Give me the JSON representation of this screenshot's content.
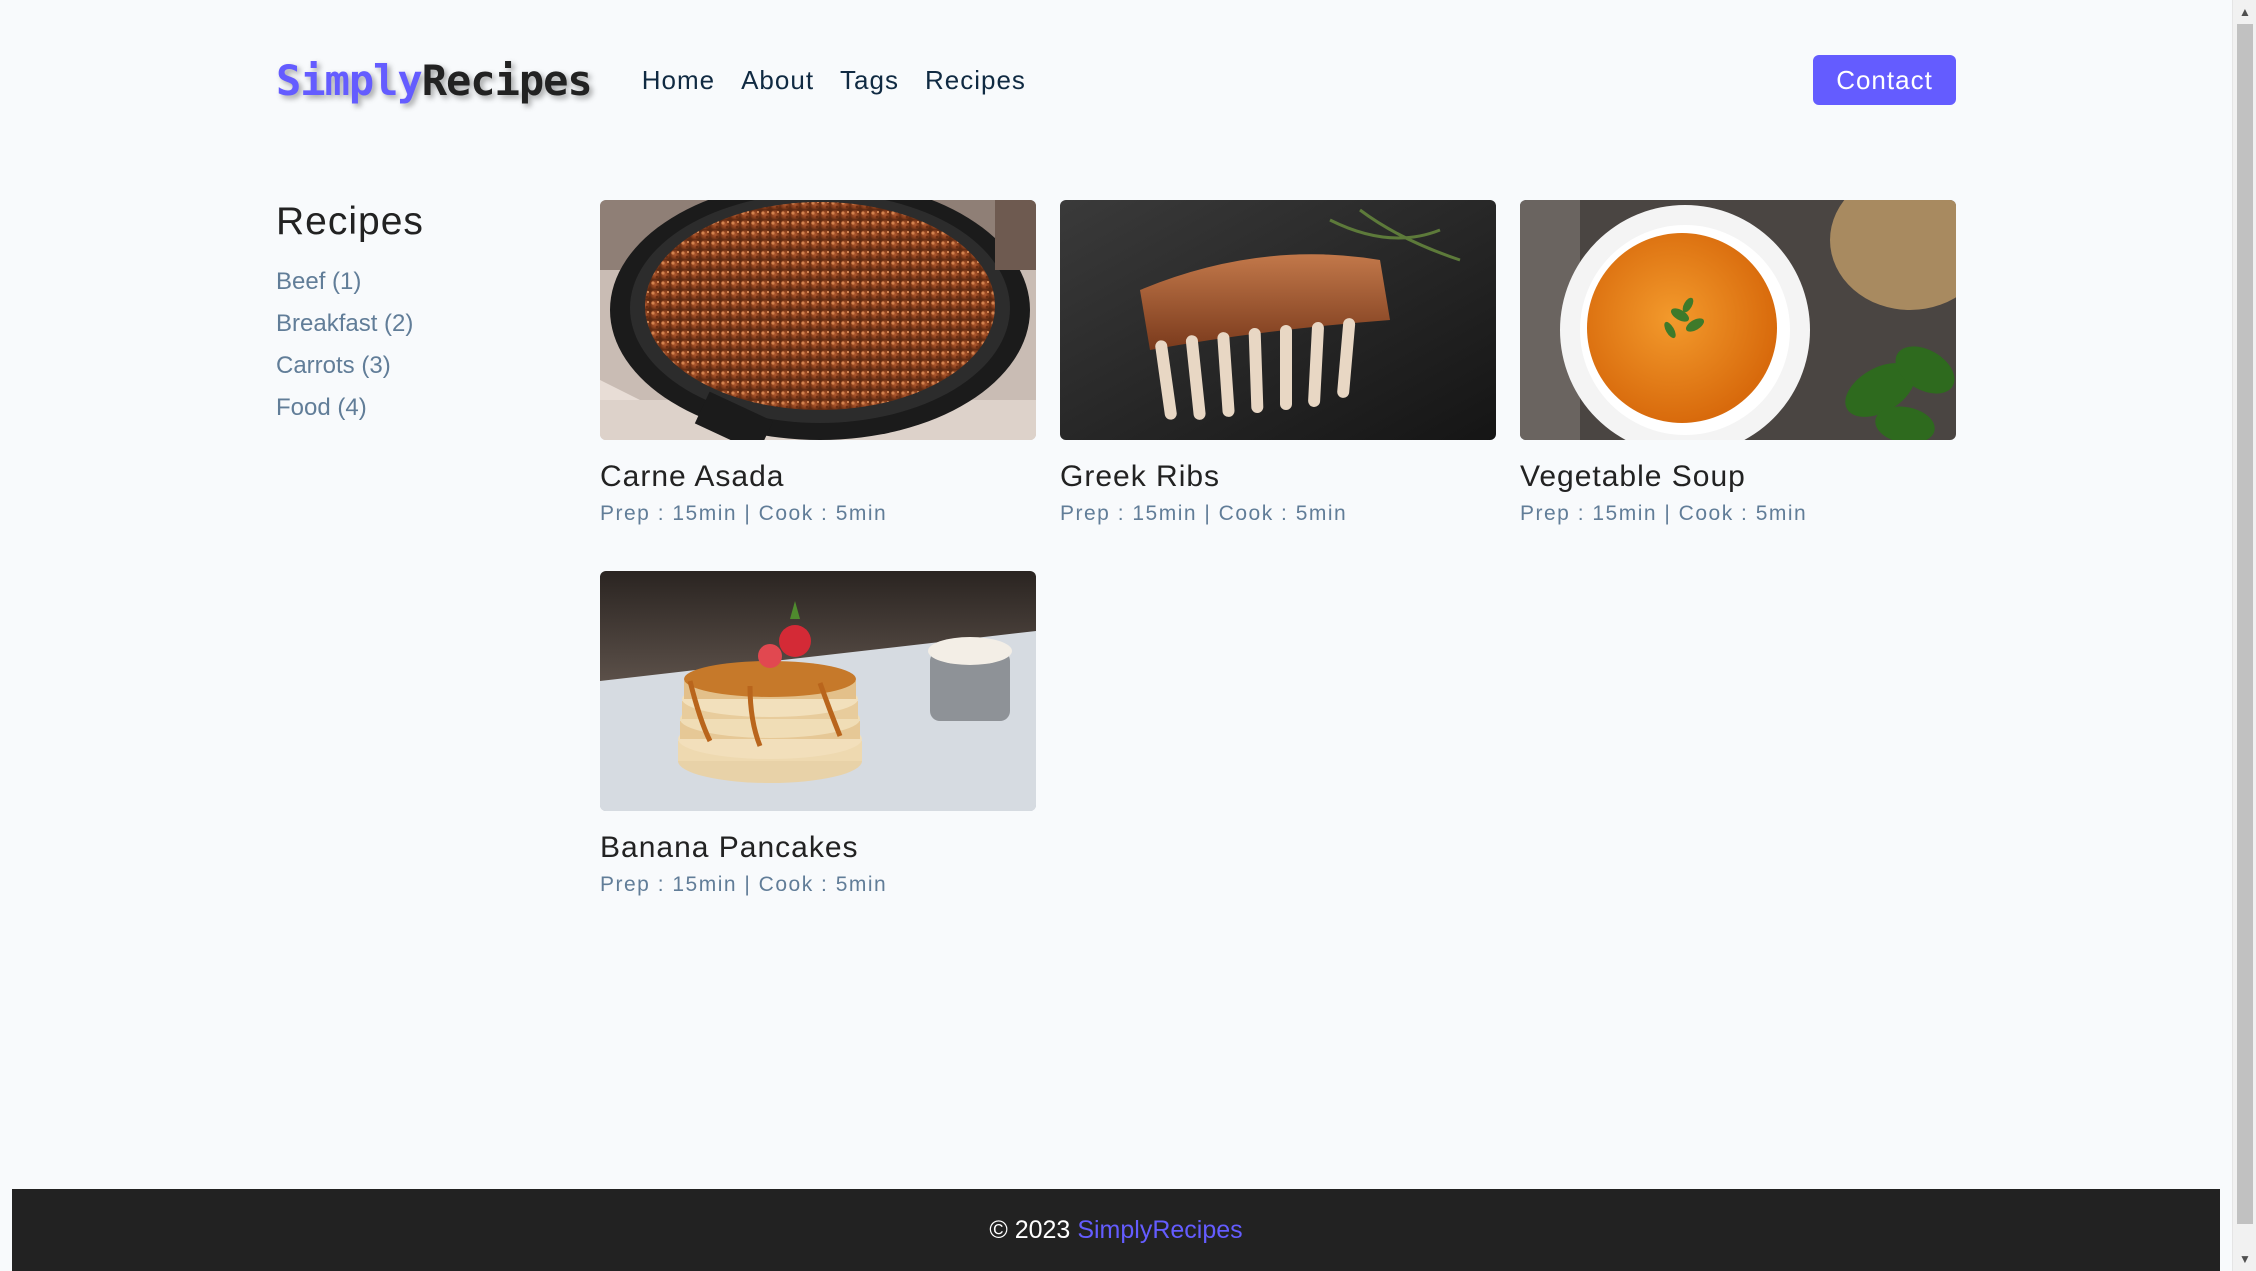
{
  "navbar": {
    "logo_part1": "Simply",
    "logo_part2": "Recipes",
    "links": [
      "Home",
      "About",
      "Tags",
      "Recipes"
    ],
    "contact_label": "Contact"
  },
  "sidebar": {
    "title": "Recipes",
    "tags": [
      "Beef (1)",
      "Breakfast (2)",
      "Carrots (3)",
      "Food (4)"
    ]
  },
  "recipes": [
    {
      "title": "Carne Asada",
      "meta": "Prep : 15min | Cook : 5min"
    },
    {
      "title": "Greek Ribs",
      "meta": "Prep : 15min | Cook : 5min"
    },
    {
      "title": "Vegetable Soup",
      "meta": "Prep : 15min | Cook : 5min"
    },
    {
      "title": "Banana Pancakes",
      "meta": "Prep : 15min | Cook : 5min"
    }
  ],
  "footer": {
    "copyright": "© 2023",
    "brand": "SimplyRecipes"
  },
  "colors": {
    "accent": "#645cff",
    "background": "#f8fafc",
    "footer": "#222222",
    "muted_text": "#617d98"
  }
}
